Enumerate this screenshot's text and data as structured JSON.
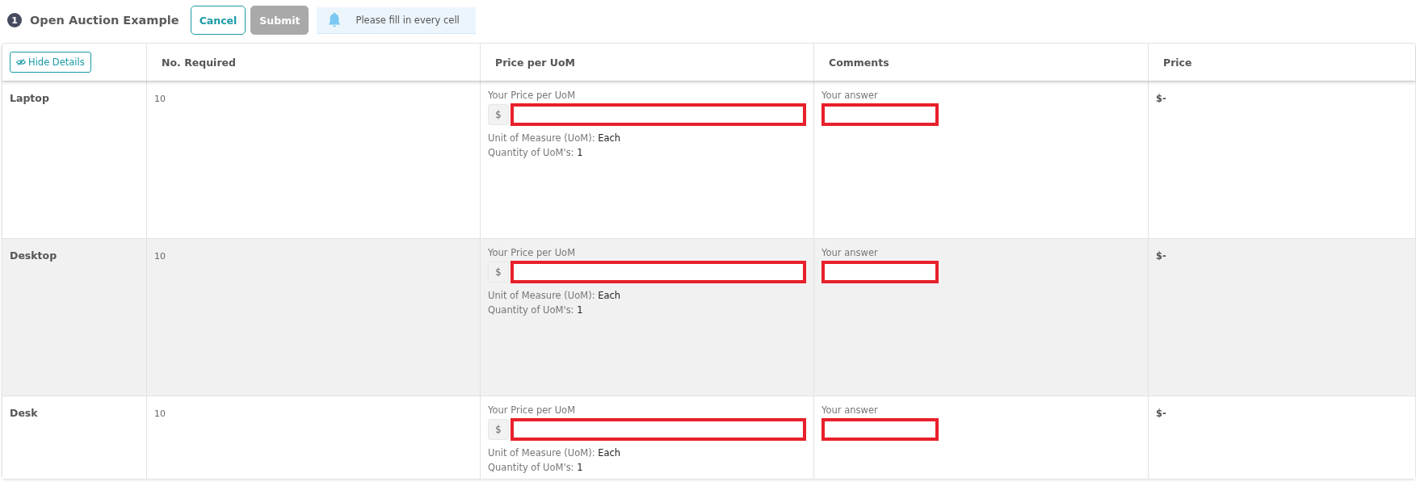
{
  "header": {
    "step": "1",
    "title": "Open Auction Example",
    "buttons": [
      {
        "label": "Cancel",
        "kind": "outline",
        "disabled": false
      },
      {
        "label": "Submit",
        "kind": "solid",
        "disabled": true
      }
    ],
    "notice": "Please fill in every cell"
  },
  "table": {
    "toggle": "Hide Details",
    "columns": [
      "No. Required",
      "Price per UoM",
      "Comments",
      "Price"
    ],
    "rows": [
      {
        "name": "Laptop",
        "shaded": false,
        "required": "10",
        "price_label": "Your Price per UoM",
        "currency": "$",
        "price_invalid": true,
        "uom_label": "Unit of Measure (UoM):",
        "uom": "Each",
        "qty_label": "Quantity of UoM's:",
        "qty": "1",
        "comment_label": "Your answer",
        "comment_invalid": true,
        "price": "$-"
      },
      {
        "name": "Desktop",
        "shaded": true,
        "required": "10",
        "price_label": "Your Price per UoM",
        "currency": "$",
        "price_invalid": true,
        "uom_label": "Unit of Measure (UoM):",
        "uom": "Each",
        "qty_label": "Quantity of UoM's:",
        "qty": "1",
        "comment_label": "Your answer",
        "comment_invalid": true,
        "price": "$-"
      },
      {
        "name": "Desk",
        "shaded": false,
        "required": "10",
        "price_label": "Your Price per UoM",
        "currency": "$",
        "price_invalid": true,
        "uom_label": "Unit of Measure (UoM):",
        "uom": "Each",
        "qty_label": "Quantity of UoM's:",
        "qty": "1",
        "comment_label": "Your answer",
        "comment_invalid": true,
        "price": "$-"
      }
    ]
  }
}
